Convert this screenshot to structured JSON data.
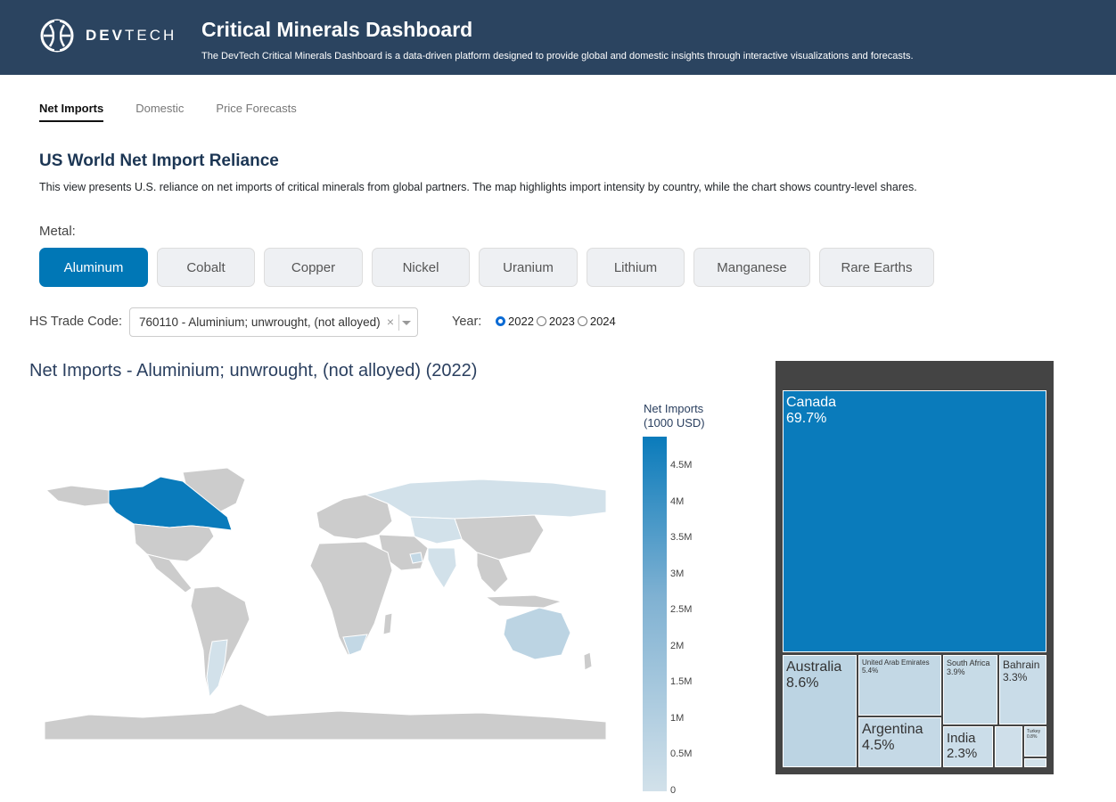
{
  "header": {
    "logo_brand_bold": "DEV",
    "logo_brand_rest": "TECH",
    "title": "Critical Minerals Dashboard",
    "subtitle": "The DevTech Critical Minerals Dashboard is a data-driven platform designed to provide global and domestic insights through interactive visualizations and forecasts."
  },
  "tabs": [
    {
      "label": "Net Imports",
      "active": true
    },
    {
      "label": "Domestic",
      "active": false
    },
    {
      "label": "Price Forecasts",
      "active": false
    }
  ],
  "section": {
    "title": "US World Net Import Reliance",
    "description": "This view presents U.S. reliance on net imports of critical minerals from global partners. The map highlights import intensity by country, while the chart shows country-level shares."
  },
  "metal": {
    "label": "Metal:",
    "options": [
      "Aluminum",
      "Cobalt",
      "Copper",
      "Nickel",
      "Uranium",
      "Lithium",
      "Manganese",
      "Rare Earths"
    ],
    "selected": "Aluminum"
  },
  "hs": {
    "label": "HS Trade Code:",
    "value": "760110 - Aluminium; unwrought, (not alloyed)",
    "clear": "×"
  },
  "year": {
    "label": "Year:",
    "options": [
      "2022",
      "2023",
      "2024"
    ],
    "selected": "2022"
  },
  "map": {
    "title": "Net Imports - Aluminium; unwrought, (not alloyed) (2022)",
    "colorbar_title_line1": "Net Imports",
    "colorbar_title_line2": "(1000 USD)",
    "colorbar_ticks": [
      "4.5M",
      "4M",
      "3.5M",
      "3M",
      "2.5M",
      "2M",
      "1.5M",
      "1M",
      "0.5M",
      "0"
    ],
    "colors": {
      "high": "#0a7bbb",
      "low": "#d2e1ea",
      "no_data": "#cccccc"
    }
  },
  "chart_data": {
    "type": "treemap",
    "items": [
      {
        "label": "Canada",
        "value": 69.7,
        "text": "69.7%"
      },
      {
        "label": "Australia",
        "value": 8.6,
        "text": "8.6%"
      },
      {
        "label": "United Arab Emirates",
        "value": 5.4,
        "text": "5.4%"
      },
      {
        "label": "Argentina",
        "value": 4.5,
        "text": "4.5%"
      },
      {
        "label": "South Africa",
        "value": 3.9,
        "text": "3.9%"
      },
      {
        "label": "Bahrain",
        "value": 3.3,
        "text": "3.3%"
      },
      {
        "label": "India",
        "value": 2.3,
        "text": "2.3%"
      },
      {
        "label": "Turkey",
        "value": 0.8,
        "text": "0.8%"
      }
    ]
  }
}
